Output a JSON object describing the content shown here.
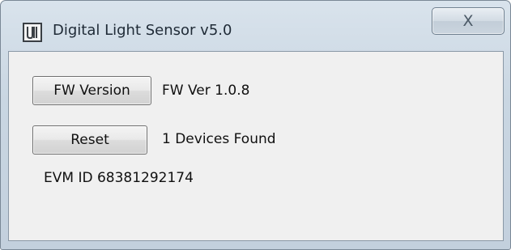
{
  "window": {
    "title": "Digital Light Sensor v5.0",
    "close_symbol": "X",
    "icon": "app-logo-icon"
  },
  "main": {
    "fw_version_button": "FW Version",
    "fw_version_text": "FW Ver 1.0.8",
    "reset_button": "Reset",
    "devices_text": "1 Devices Found",
    "evm_id_text": "EVM ID 68381292174"
  },
  "colors": {
    "title_bar": "#c9d6e2",
    "client_background": "#f0f0f0"
  }
}
